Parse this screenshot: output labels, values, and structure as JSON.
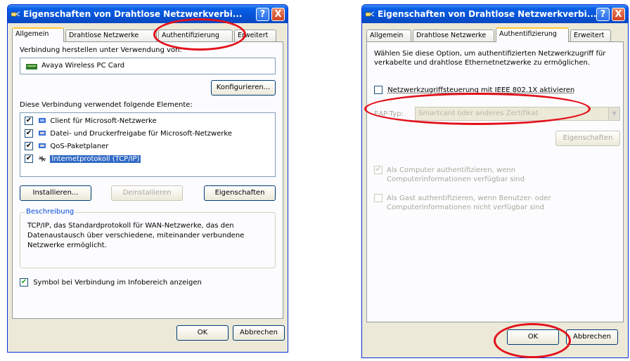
{
  "dialog1": {
    "title": "Eigenschaften von Drahtlose Netzwerkverbi...",
    "help_button": "?",
    "close_button": "X",
    "tabs": [
      "Allgemein",
      "Drahtlose Netzwerke",
      "Authentifizierung",
      "Erweitert"
    ],
    "connect_using_label": "Verbindung herstellen unter Verwendung von:",
    "adapter_name": "Avaya Wireless PC Card",
    "configure_button": "Konfigurieren...",
    "components_label": "Diese Verbindung verwendet folgende Elemente:",
    "components": [
      {
        "label": "Client für Microsoft-Netzwerke",
        "checked": true
      },
      {
        "label": "Datei- und Druckerfreigabe für Microsoft-Netzwerke",
        "checked": true
      },
      {
        "label": "QoS-Paketplaner",
        "checked": true
      },
      {
        "label": "Internetprotokoll (TCP/IP)",
        "checked": true
      }
    ],
    "install_button": "Installieren...",
    "uninstall_button": "Deinstallieren",
    "properties_button": "Eigenschaften",
    "description_group_label": "Beschreibung",
    "description_text": "TCP/IP, das Standardprotokoll für WAN-Netzwerke, das den Datenaustausch über verschiedene, miteinander verbundene Netzwerke ermöglicht.",
    "show_icon_label": "Symbol bei Verbindung im Infobereich anzeigen",
    "show_icon_checked": true,
    "ok_button": "OK",
    "cancel_button": "Abbrechen"
  },
  "dialog2": {
    "title": "Eigenschaften von Drahtlose Netzwerkverbi...",
    "help_button": "?",
    "close_button": "X",
    "tabs": [
      "Allgemein",
      "Drahtlose Netzwerke",
      "Authentifizierung",
      "Erweitert"
    ],
    "intro_text": "Wählen Sie diese Option, um authentifizierten Netzwerkzugriff für verkabelte und drahtlose Ethernetnetzwerke zu ermöglichen.",
    "ieee_label": "Netzwerkzugriffsteuerung mit IEEE 802.1X aktivieren",
    "ieee_checked": false,
    "eap_label": "EAP-Typ:",
    "eap_value": "Smartcard oder anderes Zertifikat",
    "properties_button": "Eigenschaften",
    "computer_auth_label": "Als Computer authentifizieren, wenn Computerinformationen verfügbar sind",
    "computer_auth_checked": true,
    "guest_auth_label": "Als Gast authentifizieren, wenn Benutzer- oder Computerinformationen nicht verfügbar sind",
    "guest_auth_checked": false,
    "ok_button": "OK",
    "cancel_button": "Abbrechen"
  },
  "colors": {
    "highlight_oval": "#e3101a",
    "titlebar": "#0553d6",
    "dialog_bg": "#ece9d8"
  }
}
